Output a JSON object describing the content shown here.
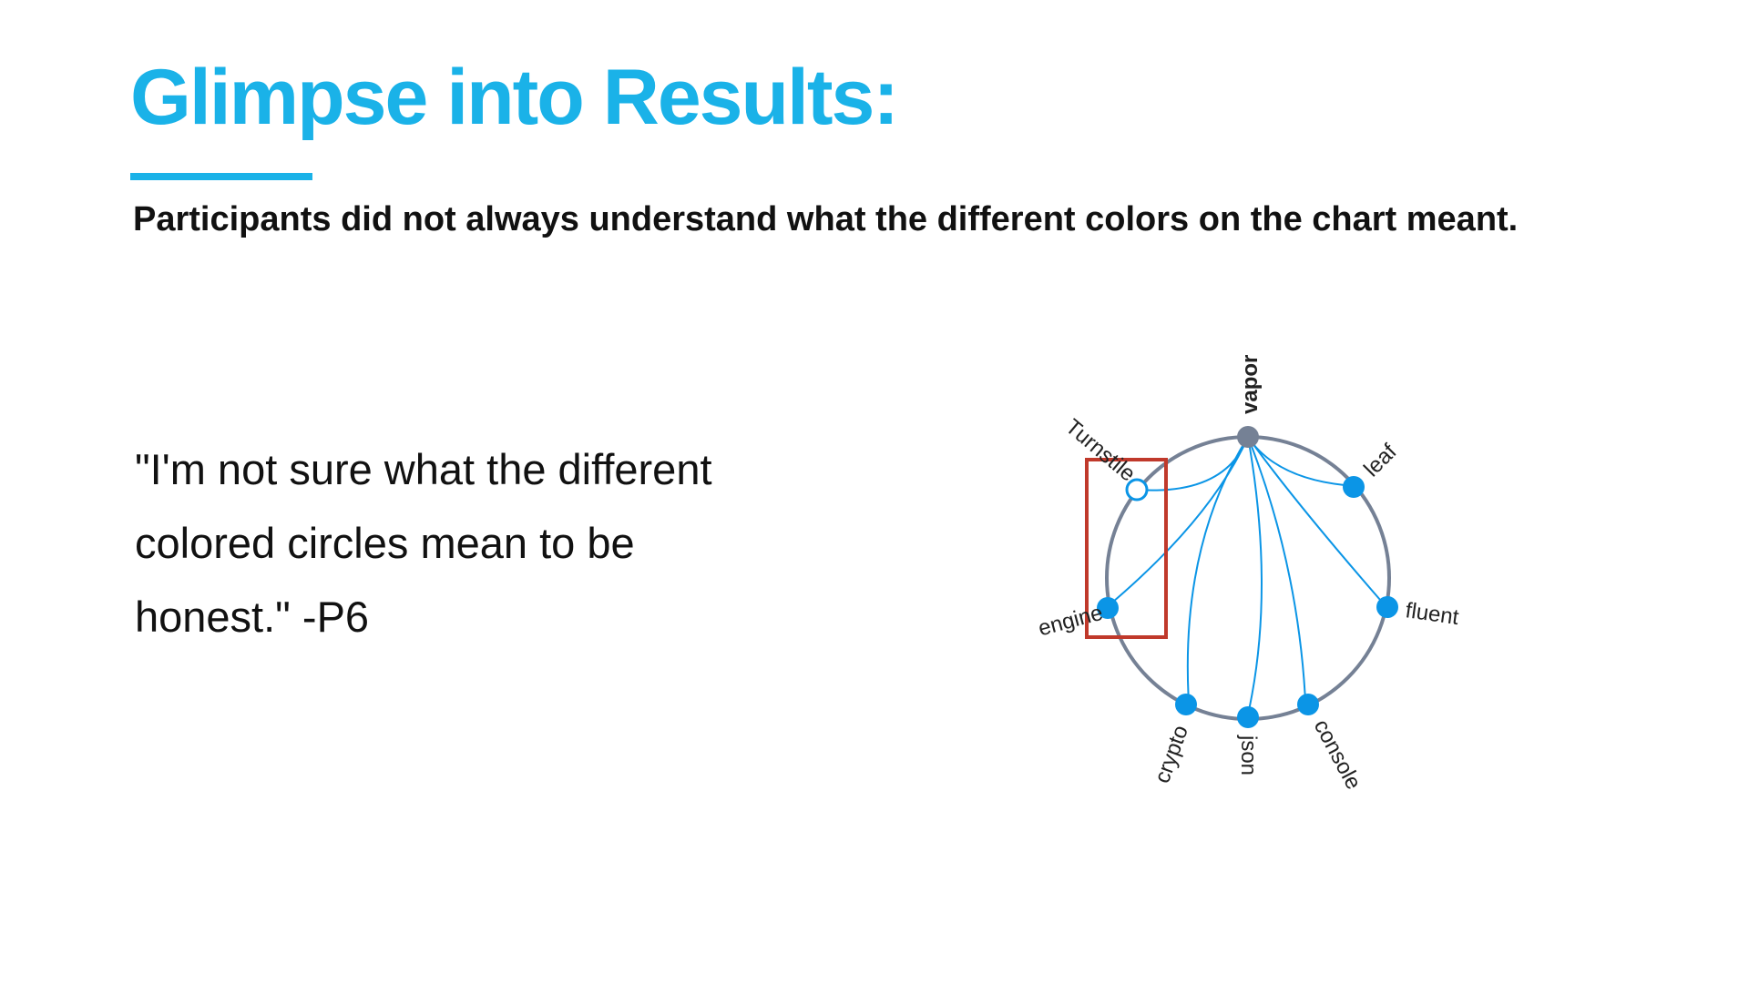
{
  "slide": {
    "title": "Glimpse into Results:",
    "subtitle": "Participants did not always understand what the different colors on the chart meant.",
    "quote": "\"I'm not sure what the different colored circles mean to be honest.\" -P6"
  },
  "diagram": {
    "nodes": [
      {
        "label": "vapor",
        "role": "root",
        "color": "#758195"
      },
      {
        "label": "leaf",
        "role": "dependency",
        "color": "#0b95e6"
      },
      {
        "label": "fluent",
        "role": "dependency",
        "color": "#0b95e6"
      },
      {
        "label": "console",
        "role": "dependency",
        "color": "#0b95e6"
      },
      {
        "label": "json",
        "role": "dependency",
        "color": "#0b95e6"
      },
      {
        "label": "crypto",
        "role": "dependency",
        "color": "#0b95e6"
      },
      {
        "label": "engine",
        "role": "dependency",
        "color": "#0b95e6"
      },
      {
        "label": "Turnstile",
        "role": "hollow",
        "color": "#ffffff"
      }
    ],
    "links": [
      [
        "vapor",
        "leaf"
      ],
      [
        "vapor",
        "fluent"
      ],
      [
        "vapor",
        "console"
      ],
      [
        "vapor",
        "json"
      ],
      [
        "vapor",
        "crypto"
      ],
      [
        "vapor",
        "engine"
      ],
      [
        "vapor",
        "Turnstile"
      ]
    ],
    "colors": {
      "ring": "#758195",
      "link": "#0b95e6",
      "highlight_box": "#c0392b"
    }
  }
}
